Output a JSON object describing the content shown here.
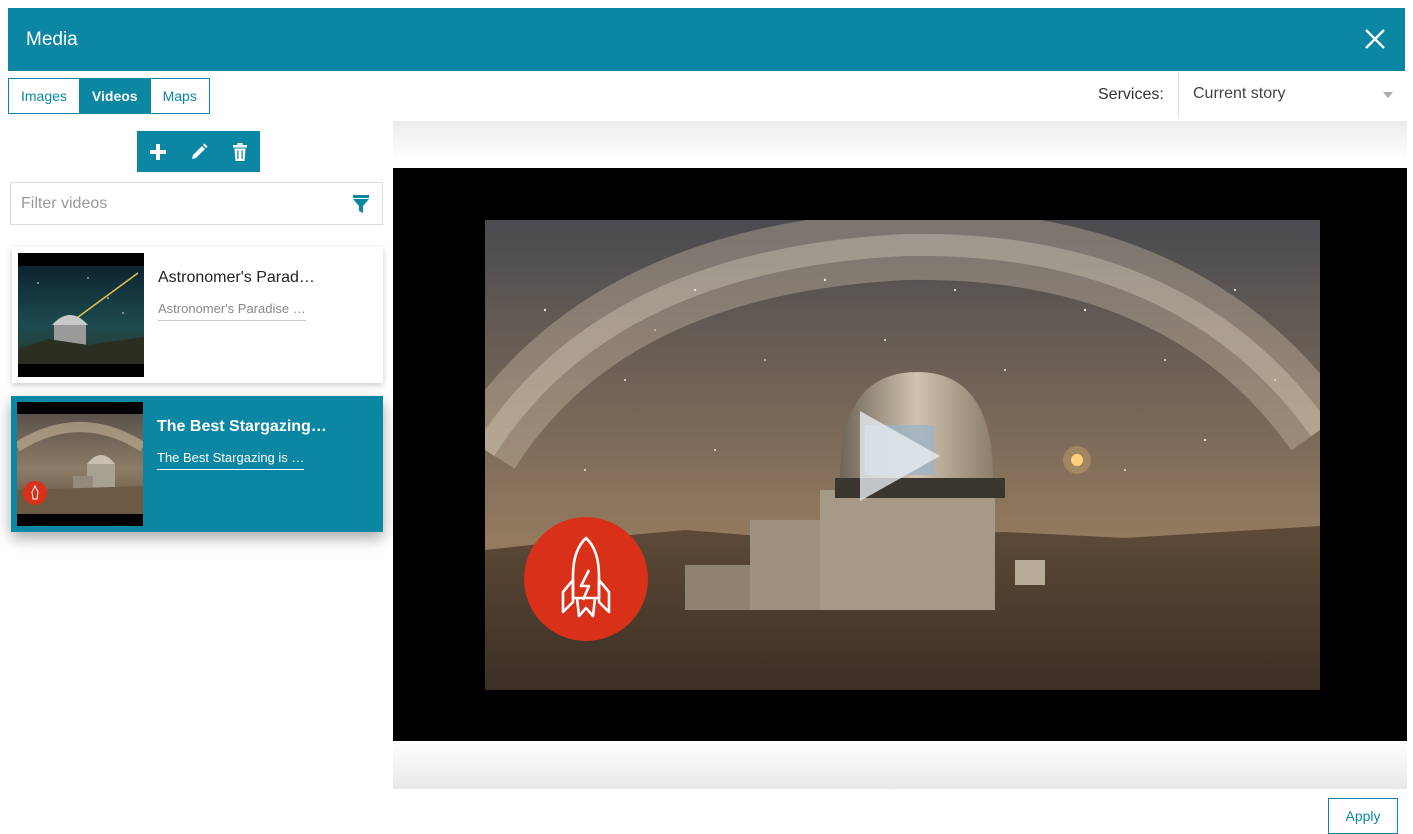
{
  "dialog": {
    "title": "Media",
    "close_icon": "close-icon"
  },
  "tabs": [
    {
      "label": "Images",
      "active": false
    },
    {
      "label": "Videos",
      "active": true
    },
    {
      "label": "Maps",
      "active": false
    }
  ],
  "services": {
    "label": "Services:",
    "selected": "Current story"
  },
  "toolbar": {
    "add_icon": "plus-icon",
    "edit_icon": "pencil-icon",
    "delete_icon": "trash-icon"
  },
  "filter": {
    "placeholder": "Filter videos",
    "value": "",
    "icon": "funnel-icon"
  },
  "videos": [
    {
      "title": "Astronomer's Parad…",
      "description": "Astronomer's Paradise …",
      "selected": false
    },
    {
      "title": "The Best Stargazing…",
      "description": "The Best Stargazing is …",
      "selected": true
    }
  ],
  "preview": {
    "play_icon": "play-icon",
    "logo_icon": "rocket-logo-icon"
  },
  "footer": {
    "apply_label": "Apply"
  },
  "colors": {
    "accent": "#0b86a3",
    "logo_red": "#d9301a"
  }
}
